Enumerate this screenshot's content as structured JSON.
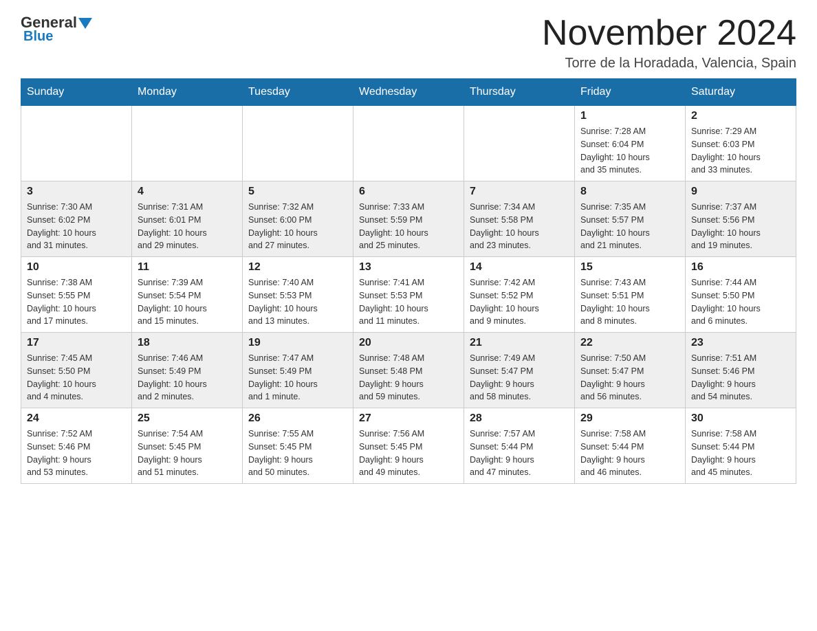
{
  "header": {
    "logo_general": "General",
    "logo_blue": "Blue",
    "month_title": "November 2024",
    "location": "Torre de la Horadada, Valencia, Spain"
  },
  "days_of_week": [
    "Sunday",
    "Monday",
    "Tuesday",
    "Wednesday",
    "Thursday",
    "Friday",
    "Saturday"
  ],
  "weeks": [
    {
      "id": "week1",
      "days": [
        {
          "number": "",
          "info": ""
        },
        {
          "number": "",
          "info": ""
        },
        {
          "number": "",
          "info": ""
        },
        {
          "number": "",
          "info": ""
        },
        {
          "number": "",
          "info": ""
        },
        {
          "number": "1",
          "info": "Sunrise: 7:28 AM\nSunset: 6:04 PM\nDaylight: 10 hours\nand 35 minutes."
        },
        {
          "number": "2",
          "info": "Sunrise: 7:29 AM\nSunset: 6:03 PM\nDaylight: 10 hours\nand 33 minutes."
        }
      ]
    },
    {
      "id": "week2",
      "days": [
        {
          "number": "3",
          "info": "Sunrise: 7:30 AM\nSunset: 6:02 PM\nDaylight: 10 hours\nand 31 minutes."
        },
        {
          "number": "4",
          "info": "Sunrise: 7:31 AM\nSunset: 6:01 PM\nDaylight: 10 hours\nand 29 minutes."
        },
        {
          "number": "5",
          "info": "Sunrise: 7:32 AM\nSunset: 6:00 PM\nDaylight: 10 hours\nand 27 minutes."
        },
        {
          "number": "6",
          "info": "Sunrise: 7:33 AM\nSunset: 5:59 PM\nDaylight: 10 hours\nand 25 minutes."
        },
        {
          "number": "7",
          "info": "Sunrise: 7:34 AM\nSunset: 5:58 PM\nDaylight: 10 hours\nand 23 minutes."
        },
        {
          "number": "8",
          "info": "Sunrise: 7:35 AM\nSunset: 5:57 PM\nDaylight: 10 hours\nand 21 minutes."
        },
        {
          "number": "9",
          "info": "Sunrise: 7:37 AM\nSunset: 5:56 PM\nDaylight: 10 hours\nand 19 minutes."
        }
      ]
    },
    {
      "id": "week3",
      "days": [
        {
          "number": "10",
          "info": "Sunrise: 7:38 AM\nSunset: 5:55 PM\nDaylight: 10 hours\nand 17 minutes."
        },
        {
          "number": "11",
          "info": "Sunrise: 7:39 AM\nSunset: 5:54 PM\nDaylight: 10 hours\nand 15 minutes."
        },
        {
          "number": "12",
          "info": "Sunrise: 7:40 AM\nSunset: 5:53 PM\nDaylight: 10 hours\nand 13 minutes."
        },
        {
          "number": "13",
          "info": "Sunrise: 7:41 AM\nSunset: 5:53 PM\nDaylight: 10 hours\nand 11 minutes."
        },
        {
          "number": "14",
          "info": "Sunrise: 7:42 AM\nSunset: 5:52 PM\nDaylight: 10 hours\nand 9 minutes."
        },
        {
          "number": "15",
          "info": "Sunrise: 7:43 AM\nSunset: 5:51 PM\nDaylight: 10 hours\nand 8 minutes."
        },
        {
          "number": "16",
          "info": "Sunrise: 7:44 AM\nSunset: 5:50 PM\nDaylight: 10 hours\nand 6 minutes."
        }
      ]
    },
    {
      "id": "week4",
      "days": [
        {
          "number": "17",
          "info": "Sunrise: 7:45 AM\nSunset: 5:50 PM\nDaylight: 10 hours\nand 4 minutes."
        },
        {
          "number": "18",
          "info": "Sunrise: 7:46 AM\nSunset: 5:49 PM\nDaylight: 10 hours\nand 2 minutes."
        },
        {
          "number": "19",
          "info": "Sunrise: 7:47 AM\nSunset: 5:49 PM\nDaylight: 10 hours\nand 1 minute."
        },
        {
          "number": "20",
          "info": "Sunrise: 7:48 AM\nSunset: 5:48 PM\nDaylight: 9 hours\nand 59 minutes."
        },
        {
          "number": "21",
          "info": "Sunrise: 7:49 AM\nSunset: 5:47 PM\nDaylight: 9 hours\nand 58 minutes."
        },
        {
          "number": "22",
          "info": "Sunrise: 7:50 AM\nSunset: 5:47 PM\nDaylight: 9 hours\nand 56 minutes."
        },
        {
          "number": "23",
          "info": "Sunrise: 7:51 AM\nSunset: 5:46 PM\nDaylight: 9 hours\nand 54 minutes."
        }
      ]
    },
    {
      "id": "week5",
      "days": [
        {
          "number": "24",
          "info": "Sunrise: 7:52 AM\nSunset: 5:46 PM\nDaylight: 9 hours\nand 53 minutes."
        },
        {
          "number": "25",
          "info": "Sunrise: 7:54 AM\nSunset: 5:45 PM\nDaylight: 9 hours\nand 51 minutes."
        },
        {
          "number": "26",
          "info": "Sunrise: 7:55 AM\nSunset: 5:45 PM\nDaylight: 9 hours\nand 50 minutes."
        },
        {
          "number": "27",
          "info": "Sunrise: 7:56 AM\nSunset: 5:45 PM\nDaylight: 9 hours\nand 49 minutes."
        },
        {
          "number": "28",
          "info": "Sunrise: 7:57 AM\nSunset: 5:44 PM\nDaylight: 9 hours\nand 47 minutes."
        },
        {
          "number": "29",
          "info": "Sunrise: 7:58 AM\nSunset: 5:44 PM\nDaylight: 9 hours\nand 46 minutes."
        },
        {
          "number": "30",
          "info": "Sunrise: 7:58 AM\nSunset: 5:44 PM\nDaylight: 9 hours\nand 45 minutes."
        }
      ]
    }
  ]
}
